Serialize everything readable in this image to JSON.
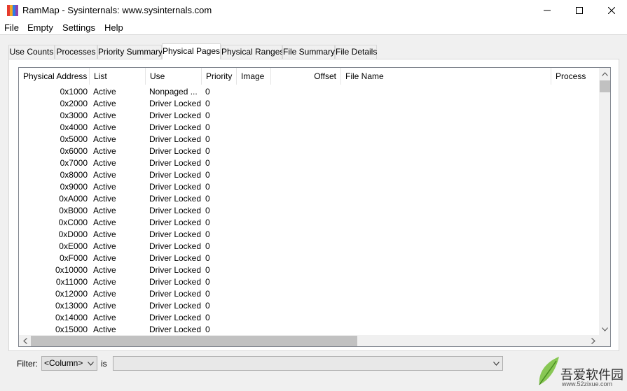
{
  "window": {
    "title": "RamMap - Sysinternals: www.sysinternals.com",
    "icon_colors": [
      "#e63b2e",
      "#f5a623",
      "#2e7de6",
      "#8e44ad"
    ]
  },
  "menu": [
    "File",
    "Empty",
    "Settings",
    "Help"
  ],
  "tabs": [
    "Use Counts",
    "Processes",
    "Priority Summary",
    "Physical Pages",
    "Physical Ranges",
    "File Summary",
    "File Details"
  ],
  "active_tab": "Physical Pages",
  "columns": [
    "Physical Address",
    "List",
    "Use",
    "Priority",
    "Image",
    "Offset",
    "File Name",
    "Process"
  ],
  "rows": [
    [
      "0x1000",
      "Active",
      "Nonpaged ...",
      "0"
    ],
    [
      "0x2000",
      "Active",
      "Driver Locked",
      "0"
    ],
    [
      "0x3000",
      "Active",
      "Driver Locked",
      "0"
    ],
    [
      "0x4000",
      "Active",
      "Driver Locked",
      "0"
    ],
    [
      "0x5000",
      "Active",
      "Driver Locked",
      "0"
    ],
    [
      "0x6000",
      "Active",
      "Driver Locked",
      "0"
    ],
    [
      "0x7000",
      "Active",
      "Driver Locked",
      "0"
    ],
    [
      "0x8000",
      "Active",
      "Driver Locked",
      "0"
    ],
    [
      "0x9000",
      "Active",
      "Driver Locked",
      "0"
    ],
    [
      "0xA000",
      "Active",
      "Driver Locked",
      "0"
    ],
    [
      "0xB000",
      "Active",
      "Driver Locked",
      "0"
    ],
    [
      "0xC000",
      "Active",
      "Driver Locked",
      "0"
    ],
    [
      "0xD000",
      "Active",
      "Driver Locked",
      "0"
    ],
    [
      "0xE000",
      "Active",
      "Driver Locked",
      "0"
    ],
    [
      "0xF000",
      "Active",
      "Driver Locked",
      "0"
    ],
    [
      "0x10000",
      "Active",
      "Driver Locked",
      "0"
    ],
    [
      "0x11000",
      "Active",
      "Driver Locked",
      "0"
    ],
    [
      "0x12000",
      "Active",
      "Driver Locked",
      "0"
    ],
    [
      "0x13000",
      "Active",
      "Driver Locked",
      "0"
    ],
    [
      "0x14000",
      "Active",
      "Driver Locked",
      "0"
    ],
    [
      "0x15000",
      "Active",
      "Driver Locked",
      "0"
    ]
  ],
  "filter": {
    "label": "Filter:",
    "column_value": "<Column>",
    "is_label": "is",
    "value": ""
  },
  "watermark": {
    "text": "吾爱软件园",
    "url": "www.52zixue.com"
  }
}
